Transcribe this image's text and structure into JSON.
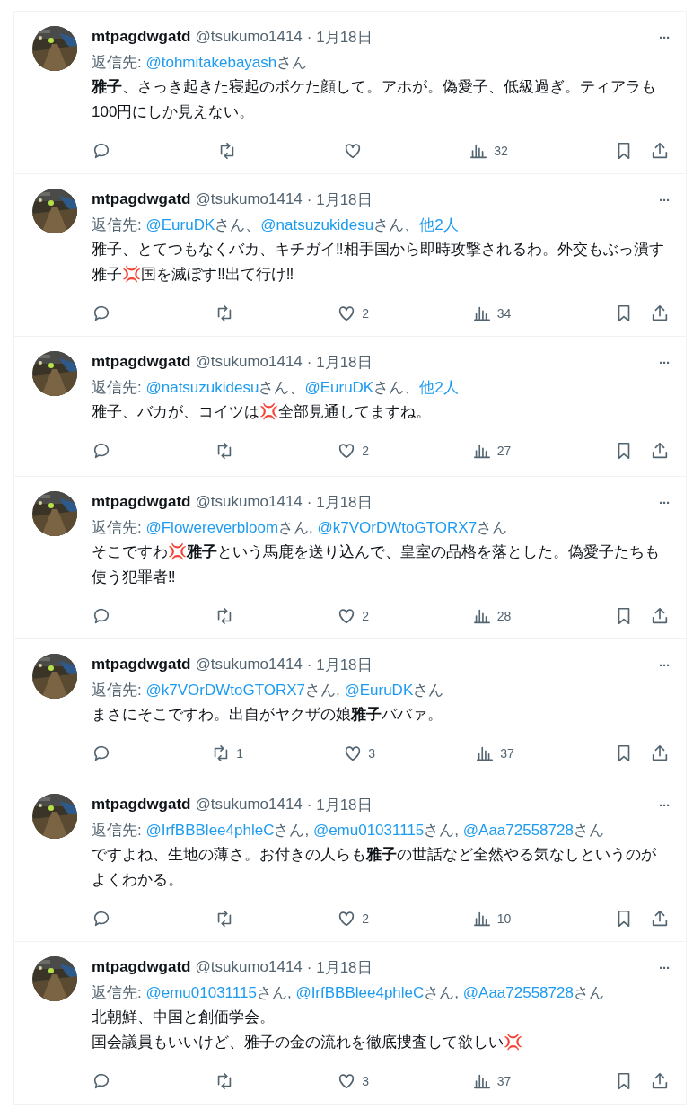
{
  "posts": [
    {
      "name": "mtpagdwgatd",
      "handle": "@tsukumo1414",
      "date": "· 1月18日",
      "more": "···",
      "reply_to": {
        "label": "返信先:",
        "mentions": [
          {
            "text": "@tohmitakebayash",
            "suffix": "さん"
          }
        ]
      },
      "body": [
        {
          "kind": "text",
          "text": "**雅子**、さっき起きた寝起のボケた顔して。アホが。偽愛子、低級過ぎ。ティアラも100円にしか見えない。"
        }
      ],
      "stats": {
        "views": "32"
      }
    },
    {
      "name": "mtpagdwgatd",
      "handle": "@tsukumo1414",
      "date": "· 1月18日",
      "more": "···",
      "reply_to": {
        "label": "返信先:",
        "mentions": [
          {
            "text": "@EuruDK",
            "suffix": "さん、"
          },
          {
            "text": "@natsuzukidesu",
            "suffix": "さん、"
          },
          {
            "text": "他2人"
          }
        ]
      },
      "body": [
        {
          "kind": "text",
          "text": "雅子、とてつもなくバカ、キチガイ‼相手国から即時攻撃されるわ。外交もぶっ潰す雅子💢国を滅ぼす‼出て行け‼"
        }
      ],
      "stats": {
        "likes": "2",
        "views": "34"
      }
    },
    {
      "name": "mtpagdwgatd",
      "handle": "@tsukumo1414",
      "date": "· 1月18日",
      "more": "···",
      "reply_to": {
        "label": "返信先:",
        "mentions": [
          {
            "text": "@natsuzukidesu",
            "suffix": "さん、"
          },
          {
            "text": "@EuruDK",
            "suffix": "さん、"
          },
          {
            "text": "他2人"
          }
        ]
      },
      "body": [
        {
          "kind": "text",
          "text": "雅子、バカが、コイツは💢全部見通してますね。"
        }
      ],
      "stats": {
        "likes": "2",
        "views": "27"
      }
    },
    {
      "name": "mtpagdwgatd",
      "handle": "@tsukumo1414",
      "date": "· 1月18日",
      "more": "···",
      "reply_to": {
        "label": "返信先:",
        "mentions": [
          {
            "text": "@Flowereverbloom",
            "suffix": "さん, "
          },
          {
            "text": "@k7VOrDWtoGTORX7",
            "suffix": "さん"
          }
        ]
      },
      "body": [
        {
          "kind": "text",
          "text": "そこですわ💢**雅子**という馬鹿を送り込んで、皇室の品格を落とした。偽愛子たちも使う犯罪者‼"
        }
      ],
      "stats": {
        "likes": "2",
        "views": "28"
      }
    },
    {
      "name": "mtpagdwgatd",
      "handle": "@tsukumo1414",
      "date": "· 1月18日",
      "more": "···",
      "reply_to": {
        "label": "返信先:",
        "mentions": [
          {
            "text": "@k7VOrDWtoGTORX7",
            "suffix": "さん, "
          },
          {
            "text": "@EuruDK",
            "suffix": "さん"
          }
        ]
      },
      "body": [
        {
          "kind": "text",
          "text": "まさにそこですわ。出自がヤクザの娘**雅子**ババァ。"
        }
      ],
      "stats": {
        "reposts": "1",
        "likes": "3",
        "views": "37"
      }
    },
    {
      "name": "mtpagdwgatd",
      "handle": "@tsukumo1414",
      "date": "· 1月18日",
      "more": "···",
      "reply_to": {
        "label": "返信先:",
        "mentions": [
          {
            "text": "@IrfBBBlee4phleC",
            "suffix": "さん, "
          },
          {
            "text": "@emu01031115",
            "suffix": "さん, "
          },
          {
            "text": "@Aaa72558728",
            "suffix": "さん"
          }
        ]
      },
      "body": [
        {
          "kind": "text",
          "text": "ですよね、生地の薄さ。お付きの人らも**雅子**の世話など全然やる気なしというのがよくわかる。"
        }
      ],
      "stats": {
        "likes": "2",
        "views": "10"
      }
    },
    {
      "name": "mtpagdwgatd",
      "handle": "@tsukumo1414",
      "date": "· 1月18日",
      "more": "···",
      "reply_to": {
        "label": "返信先:",
        "mentions": [
          {
            "text": "@emu01031115",
            "suffix": "さん, "
          },
          {
            "text": "@IrfBBBlee4phleC",
            "suffix": "さん, "
          },
          {
            "text": "@Aaa72558728",
            "suffix": "さん"
          }
        ]
      },
      "body": [
        {
          "kind": "text",
          "text": "北朝鮮、中国と創価学会。"
        },
        {
          "kind": "text",
          "text": "国会議員もいいけど、雅子の金の流れを徹底捜査して欲しい💢"
        }
      ],
      "stats": {
        "likes": "3",
        "views": "37"
      }
    }
  ]
}
